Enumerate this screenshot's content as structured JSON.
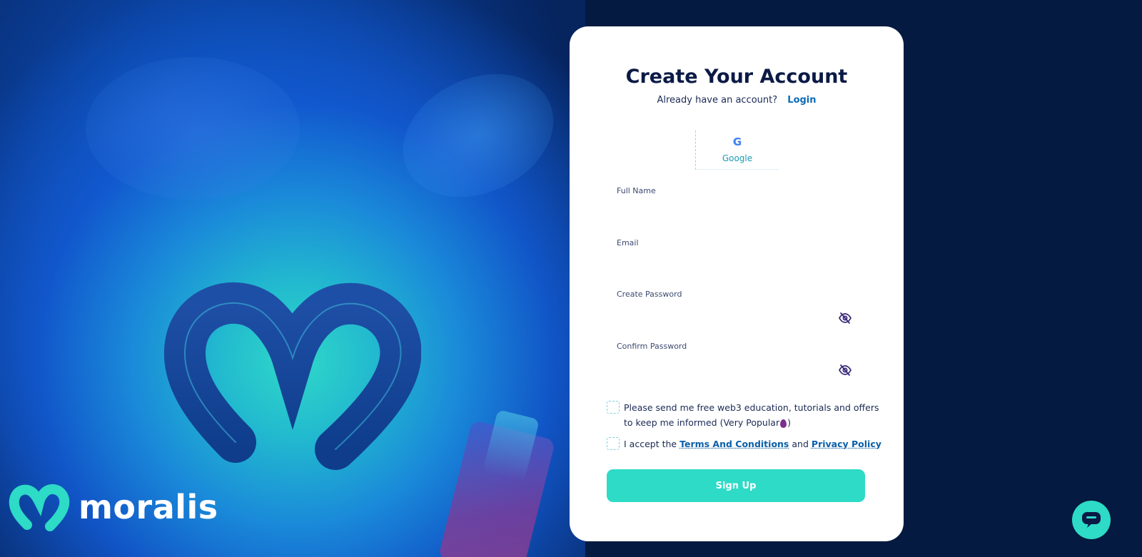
{
  "brand": {
    "name": "moralis",
    "accent": "#2ddbc6",
    "logo_icon": "moralis-heart-logo"
  },
  "signup_form": {
    "title": "Create Your Account",
    "have_account_text": "Already have an account?",
    "login_link": "Login",
    "social": {
      "google_label": "Google",
      "google_icon": "google-g-icon",
      "google_glyph": "G"
    },
    "fields": {
      "full_name": {
        "label": "Full Name",
        "value": ""
      },
      "email": {
        "label": "Email",
        "value": ""
      },
      "create_password": {
        "label": "Create Password",
        "value": "",
        "icon": "eye-off-icon"
      },
      "confirm_password": {
        "label": "Confirm Password",
        "value": "",
        "icon": "eye-off-icon"
      }
    },
    "newsletter": {
      "checked": false,
      "text_line1": "Please send me free web3 education, tutorials and offers",
      "text_line2_start": "to keep me informed (Very Popular",
      "text_line2_end": ")"
    },
    "terms": {
      "checked": false,
      "prefix": "I accept the",
      "terms_link": "Terms And Conditions",
      "and": "and",
      "privacy_link": "Privacy Policy"
    },
    "submit_label": "Sign Up"
  },
  "support_chat": {
    "icon": "chat-bubble-icon"
  }
}
